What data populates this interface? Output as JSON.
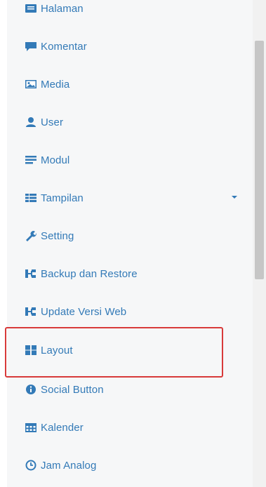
{
  "menu": {
    "items": [
      {
        "label": "Halaman",
        "icon": "file-icon"
      },
      {
        "label": "Komentar",
        "icon": "comment-icon"
      },
      {
        "label": "Media",
        "icon": "image-icon"
      },
      {
        "label": "User",
        "icon": "user-icon"
      },
      {
        "label": "Modul",
        "icon": "list-icon"
      },
      {
        "label": "Tampilan",
        "icon": "columns-icon",
        "has_dropdown": true
      },
      {
        "label": "Setting",
        "icon": "wrench-icon"
      },
      {
        "label": "Backup dan Restore",
        "icon": "sitemap-icon"
      },
      {
        "label": "Update Versi Web",
        "icon": "sitemap-icon"
      },
      {
        "label": "Layout",
        "icon": "grid-icon",
        "highlighted": true
      },
      {
        "label": "Social Button",
        "icon": "info-circle-icon"
      },
      {
        "label": "Kalender",
        "icon": "calendar-icon"
      },
      {
        "label": "Jam Analog",
        "icon": "clock-icon"
      }
    ]
  },
  "colors": {
    "link": "#337ab7",
    "highlight_border": "#d83a3a",
    "sidebar_bg": "#f6f7f8"
  }
}
